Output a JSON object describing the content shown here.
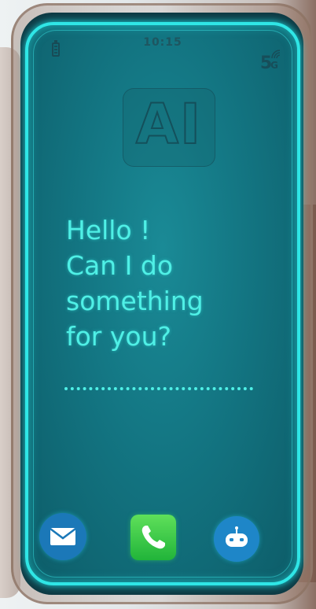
{
  "status": {
    "time": "10:15",
    "network": "5",
    "network_suffix": "G",
    "battery_icon": "battery-icon",
    "signal_icon": "wifi-signal-icon"
  },
  "badge": {
    "text": "AI"
  },
  "greeting": {
    "lines": [
      "Hello !",
      "Can I do",
      "something",
      "for you?"
    ]
  },
  "dock": {
    "items": [
      {
        "icon": "mail-icon"
      },
      {
        "icon": "phone-icon"
      },
      {
        "icon": "robot-icon"
      }
    ]
  },
  "colors": {
    "screen": "#137582",
    "glow": "#2fe6e6",
    "text": "#4ff0e6",
    "mail": "#1b78b8",
    "phone": "#21b43a",
    "bot": "#1e86c8"
  }
}
